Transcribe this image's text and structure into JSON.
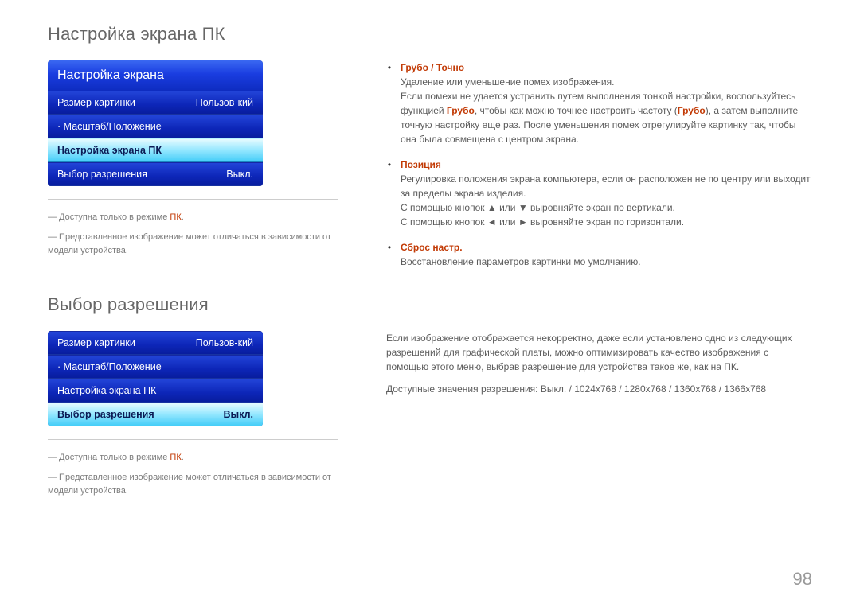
{
  "page_number": "98",
  "sec1": {
    "title": "Настройка экрана ПК",
    "osd_title": "Настройка экрана",
    "rows": [
      {
        "label": "Размер картинки",
        "value": "Пользов-кий",
        "bullet": false,
        "selected": false
      },
      {
        "label": "Масштаб/Положение",
        "value": "",
        "bullet": true,
        "selected": false
      },
      {
        "label": "Настройка экрана ПК",
        "value": "",
        "bullet": false,
        "selected": true
      },
      {
        "label": "Выбор разрешения",
        "value": "Выкл.",
        "bullet": false,
        "selected": false
      }
    ],
    "foot_a_pre": "― Доступна только в режиме ",
    "foot_a_red": "ПК",
    "foot_a_post": ".",
    "foot_b": "― Представленное изображение может отличаться в зависимости от модели устройства.",
    "b1_title": "Грубо / Точно",
    "b1_p1": "Удаление или уменьшение помех изображения.",
    "b1_p2a": "Если помехи не удается устранить путем выполнения тонкой настройки, воспользуйтесь функцией ",
    "b1_p2red1": "Грубо",
    "b1_p2b": ", чтобы как можно точнее настроить частоту (",
    "b1_p2red2": "Грубо",
    "b1_p2c": "), а затем выполните точную настройку еще раз. После уменьшения помех отрегулируйте картинку так, чтобы она была совмещена с центром экрана.",
    "b2_title": "Позиция",
    "b2_p1": "Регулировка положения экрана компьютера, если он расположен не по центру или выходит за пределы экрана изделия.",
    "b2_p2": "С помощью кнопок ▲ или ▼ выровняйте экран по вертикали.",
    "b2_p3": "С помощью кнопок ◄ или ► выровняйте экран по горизонтали.",
    "b3_title": "Сброс настр.",
    "b3_p1": "Восстановление параметров картинки мо умолчанию."
  },
  "sec2": {
    "title": "Выбор разрешения",
    "rows": [
      {
        "label": "Размер картинки",
        "value": "Пользов-кий",
        "bullet": false,
        "selected": false
      },
      {
        "label": "Масштаб/Положение",
        "value": "",
        "bullet": true,
        "selected": false
      },
      {
        "label": "Настройка экрана ПК",
        "value": "",
        "bullet": false,
        "selected": false
      },
      {
        "label": "Выбор разрешения",
        "value": "Выкл.",
        "bullet": false,
        "selected": true
      }
    ],
    "foot_a_pre": "― Доступна только в режиме ",
    "foot_a_red": "ПК",
    "foot_a_post": ".",
    "foot_b": "― Представленное изображение может отличаться в зависимости от модели устройства.",
    "r_p1": "Если изображение отображается некорректно, даже если установлено одно из следующих разрешений для графической платы, можно оптимизировать качество изображения с помощью этого меню, выбрав разрешение для устройства такое же, как на ПК.",
    "r_p2_pre": "Доступные значения разрешения: ",
    "r_p2_v1": "Выкл.",
    "r_p2_v2": "1024x768",
    "r_p2_v3": "1280x768",
    "r_p2_v4": "1360x768",
    "r_p2_v5": "1366x768"
  }
}
